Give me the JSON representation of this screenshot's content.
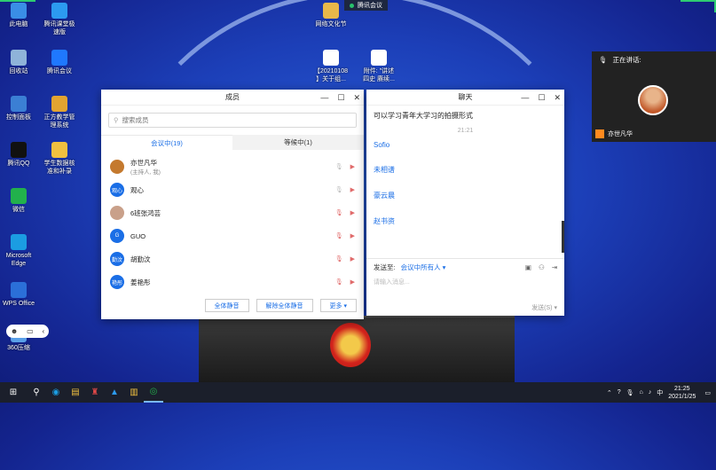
{
  "desktop": {
    "icons_left": [
      {
        "label": "此电脑",
        "icon": "computer-icon",
        "color": "#3a8ee6"
      },
      {
        "label": "腾讯课堂极\n速版",
        "icon": "tencent-classroom-icon",
        "color": "#2c9af0"
      },
      {
        "label": "回收站",
        "icon": "recycle-bin-icon",
        "color": "#8fb3d9"
      },
      {
        "label": "腾讯会议",
        "icon": "tencent-meeting-icon",
        "color": "#1f78ff"
      },
      {
        "label": "控制面板",
        "icon": "control-panel-icon",
        "color": "#3b7fd4"
      },
      {
        "label": "正方教学管\n理系统",
        "icon": "teaching-system-icon",
        "color": "#e3a431"
      },
      {
        "label": "腾讯QQ",
        "icon": "qq-icon",
        "color": "#111111"
      },
      {
        "label": "学生数据核\n准和补录",
        "icon": "document-icon",
        "color": "#f0c040"
      },
      {
        "label": "微信",
        "icon": "wechat-icon",
        "color": "#22b14c"
      },
      {
        "label": "Microsoft\nEdge",
        "icon": "edge-icon",
        "color": "#1b9de2"
      },
      {
        "label": "WPS Office",
        "icon": "wps-icon",
        "color": "#2b6fd8"
      },
      {
        "label": "360压缩",
        "icon": "zip-icon",
        "color": "#5aa0e8"
      }
    ],
    "icons_center": [
      {
        "label": "网络文化节",
        "icon": "folder-icon"
      },
      {
        "label": "【20210108\n】关于组...",
        "icon": "word-doc-icon"
      },
      {
        "label": "附件: \"讲述\n四史 赓续...",
        "icon": "word-doc-icon"
      }
    ],
    "meeting_badge": "腾讯会议"
  },
  "members_window": {
    "title": "成员",
    "search_placeholder": "搜索成员",
    "tab_in_meeting": "会议中(19)",
    "tab_waiting": "等候中(1)",
    "members": [
      {
        "name": "亦世凡华",
        "sub": "(主持人, 我)",
        "avatar_text": "",
        "avatar_color": "#c4792e"
      },
      {
        "name": "观心",
        "sub": "",
        "avatar_text": "观心",
        "avatar_color": "#1a6ee6"
      },
      {
        "name": "6班张鸿芸",
        "sub": "",
        "avatar_text": "",
        "avatar_color": "#c9a08a"
      },
      {
        "name": "GUO",
        "sub": "",
        "avatar_text": "G",
        "avatar_color": "#1a6ee6"
      },
      {
        "name": "胡勤汶",
        "sub": "",
        "avatar_text": "勤汶",
        "avatar_color": "#1a6ee6"
      },
      {
        "name": "姜艳彤",
        "sub": "",
        "avatar_text": "艳彤",
        "avatar_color": "#1a6ee6"
      }
    ],
    "btn_mute_all": "全体静音",
    "btn_unmute_all": "解除全体静音",
    "btn_more": "更多 ▾"
  },
  "chat_window": {
    "title": "聊天",
    "message": "可以学习青年大学习的拍摄形式",
    "time": "21:21",
    "senders": [
      "Sofio",
      "未相谱",
      "豪云晨",
      "赵书资"
    ],
    "send_to_label": "发送至:",
    "send_to_value": "会议中所有人 ▾",
    "input_placeholder": "请输入消息...",
    "send_button": "发送(S)"
  },
  "speaker_panel": {
    "label": "正在讲话:",
    "name": "亦世凡华"
  },
  "taskbar": {
    "ime": "中",
    "time": "21:25",
    "date": "2021/1/25"
  }
}
